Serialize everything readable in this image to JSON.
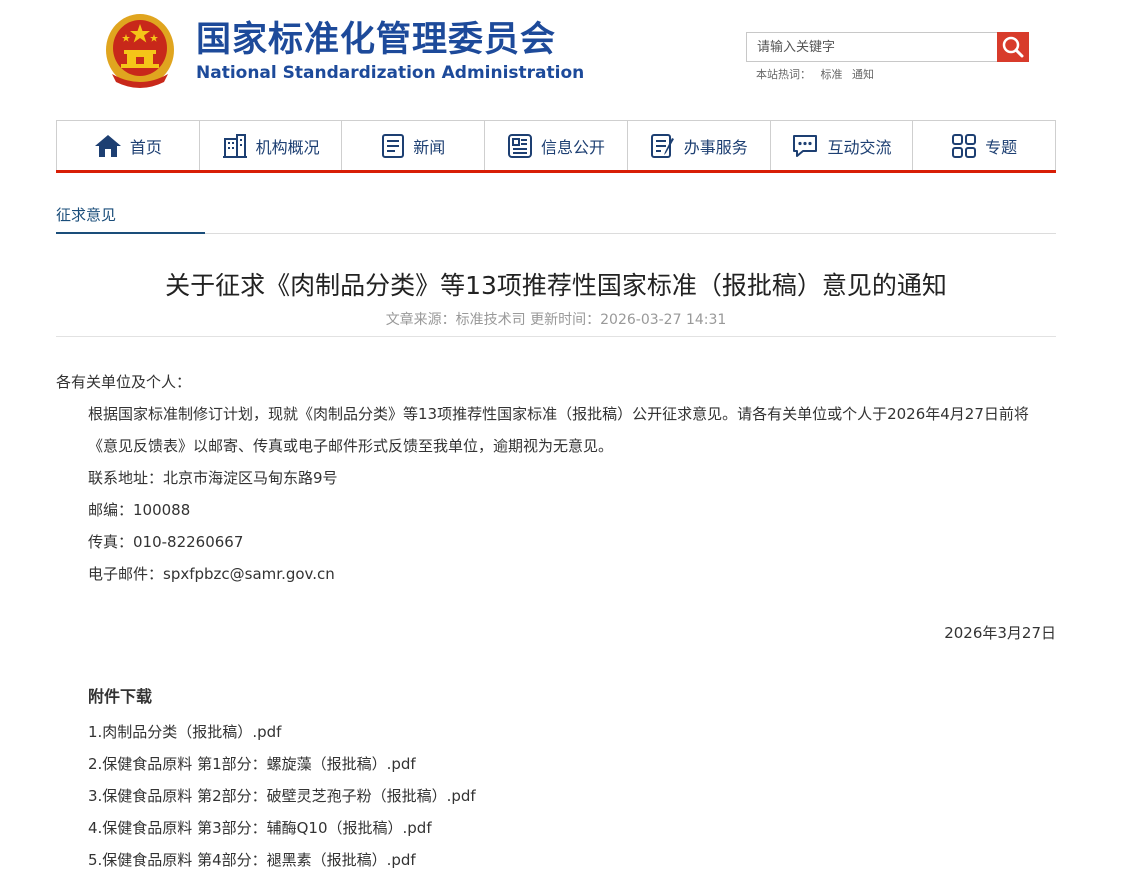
{
  "header": {
    "title_cn": "国家标准化管理委员会",
    "title_en": "National Standardization Administration",
    "search_placeholder": "请输入关键字",
    "hot_label": "本站热词：",
    "hot_words": [
      "标准",
      "通知"
    ]
  },
  "nav": [
    {
      "label": "首页",
      "icon": "home-icon"
    },
    {
      "label": "机构概况",
      "icon": "building-icon"
    },
    {
      "label": "新闻",
      "icon": "news-icon"
    },
    {
      "label": "信息公开",
      "icon": "info-icon"
    },
    {
      "label": "办事服务",
      "icon": "service-icon"
    },
    {
      "label": "互动交流",
      "icon": "chat-icon"
    },
    {
      "label": "专题",
      "icon": "grid-icon"
    }
  ],
  "breadcrumb": "征求意见",
  "article": {
    "title": "关于征求《肉制品分类》等13项推荐性国家标准（报批稿）意见的通知",
    "meta": "文章来源：标准技术司 更新时间：2026-03-27 14:31",
    "salutation": "各有关单位及个人：",
    "paragraph": "根据国家标准制修订计划，现就《肉制品分类》等13项推荐性国家标准（报批稿）公开征求意见。请各有关单位或个人于2026年4月27日前将《意见反馈表》以邮寄、传真或电子邮件形式反馈至我单位，逾期视为无意见。",
    "address": "联系地址：北京市海淀区马甸东路9号",
    "postcode": "邮编：100088",
    "fax": "传真：010-82260667",
    "email": "电子邮件：spxfpbzc@samr.gov.cn",
    "date": "2026年3月27日"
  },
  "attachments": {
    "title": "附件下载",
    "items": [
      "1.肉制品分类（报批稿）.pdf",
      "2.保健食品原料 第1部分：螺旋藻（报批稿）.pdf",
      "3.保健食品原料 第2部分：破壁灵芝孢子粉（报批稿）.pdf",
      "4.保健食品原料 第3部分：辅酶Q10（报批稿）.pdf",
      "5.保健食品原料 第4部分：褪黑素（报批稿）.pdf"
    ]
  },
  "colors": {
    "brand_blue": "#1d4a9a",
    "nav_red": "#d81e06",
    "search_red": "#d83b2b"
  }
}
